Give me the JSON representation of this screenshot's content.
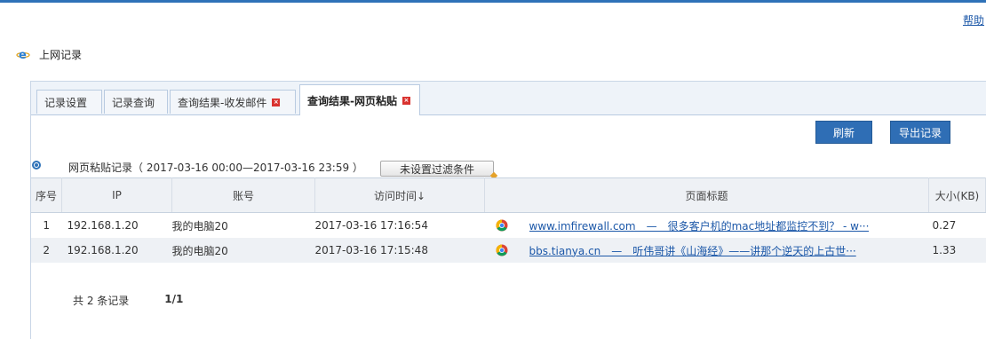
{
  "header": {
    "help_label": "帮助"
  },
  "window": {
    "title": "上网记录"
  },
  "tabs": [
    {
      "label": "记录设置",
      "closable": false,
      "active": false
    },
    {
      "label": "记录查询",
      "closable": false,
      "active": false
    },
    {
      "label": "查询结果-收发邮件",
      "closable": true,
      "active": false
    },
    {
      "label": "查询结果-网页粘贴",
      "closable": true,
      "active": true
    }
  ],
  "toolbar": {
    "refresh_label": "刷新",
    "export_label": "导出记录"
  },
  "record": {
    "title": "网页粘贴记录（ 2017-03-16 00:00—2017-03-16 23:59 ）",
    "filter_label": "未设置过滤条件"
  },
  "table": {
    "columns": [
      "序号",
      "IP",
      "账号",
      "访问时间↓",
      "页面标题",
      "大小(KB)"
    ],
    "rows": [
      {
        "index": "1",
        "ip": "192.168.1.20",
        "account": "我的电脑20",
        "time": "2017-03-16 17:16:54",
        "title": "www.imfirewall.com　—　很多客户机的mac地址都监控不到？ - w···",
        "size": "0.27"
      },
      {
        "index": "2",
        "ip": "192.168.1.20",
        "account": "我的电脑20",
        "time": "2017-03-16 17:15:48",
        "title": "bbs.tianya.cn　—　听伟哥讲《山海经》——讲那个逆天的上古世···",
        "size": "1.33"
      }
    ]
  },
  "footer": {
    "total_text": "共 2 条记录",
    "page_text": "1/1"
  },
  "colors": {
    "accent": "#2f72b8",
    "button": "#2f6eb5",
    "close": "#d9322f"
  },
  "icons": {
    "window": "ie-icon",
    "row": "chrome-icon",
    "radio": "radio-icon"
  }
}
